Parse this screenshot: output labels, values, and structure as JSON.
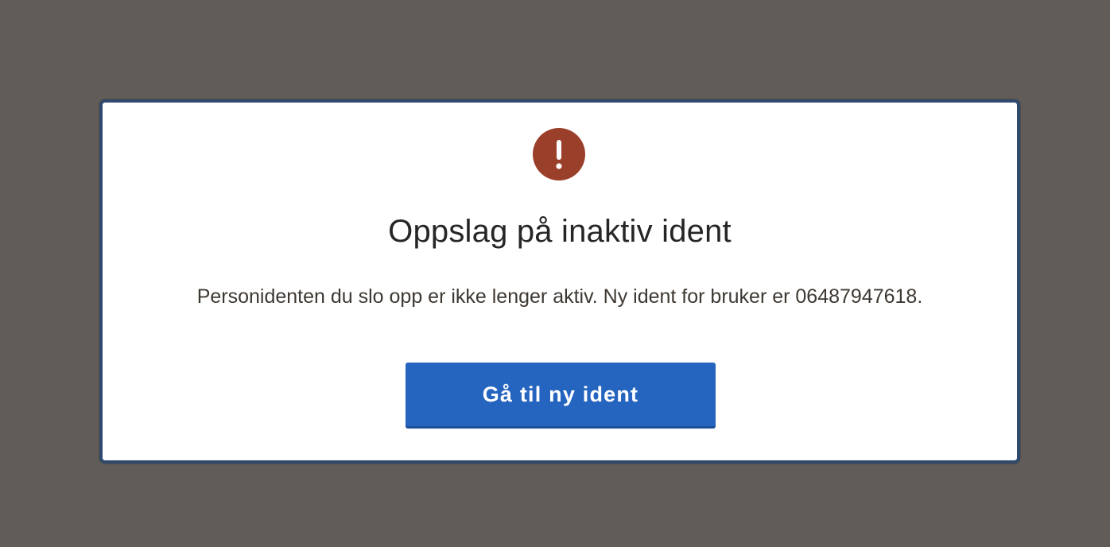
{
  "dialog": {
    "icon": "exclamation-circle-icon",
    "icon_color": "#9a3f2a",
    "title": "Oppslag på inaktiv ident",
    "message": "Personidenten du slo opp er ikke lenger aktiv. Ny ident for bruker er 06487947618.",
    "button_label": "Gå til ny ident",
    "button_color": "#2665bf",
    "border_color": "#2f4a6e"
  },
  "backdrop_color": "#615c57"
}
